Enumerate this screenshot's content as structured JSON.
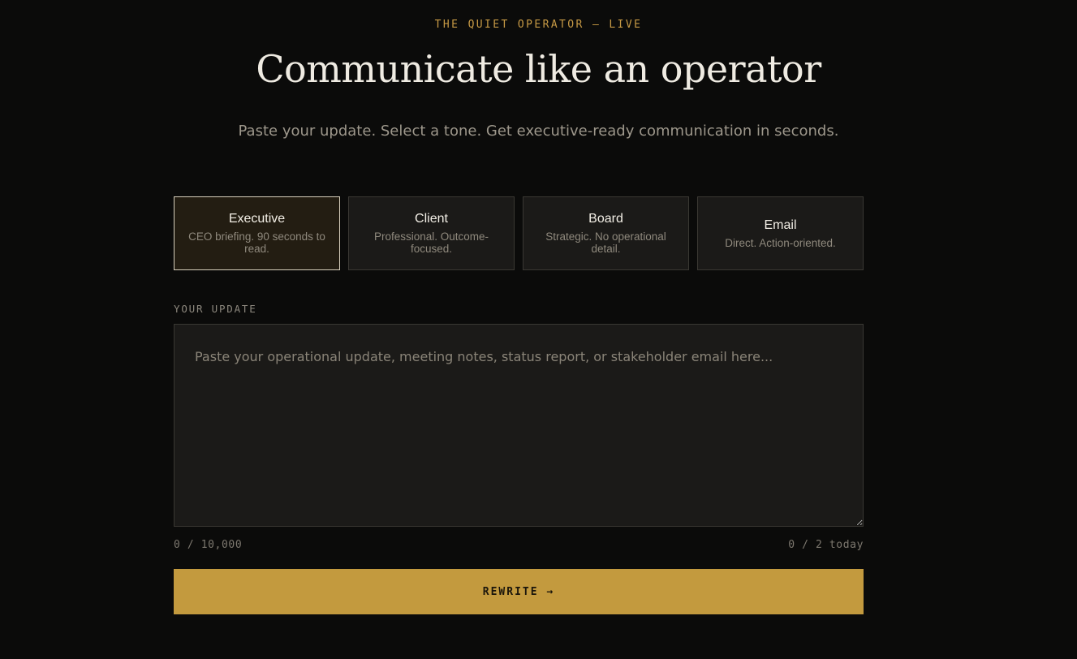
{
  "header": {
    "eyebrow": "THE QUIET OPERATOR — LIVE",
    "title": "Communicate like an operator",
    "subtitle": "Paste your update. Select a tone. Get executive-ready communication in seconds."
  },
  "tones": [
    {
      "name": "Executive",
      "description": "CEO briefing. 90 seconds to read.",
      "selected": true
    },
    {
      "name": "Client",
      "description": "Professional. Outcome-focused.",
      "selected": false
    },
    {
      "name": "Board",
      "description": "Strategic. No operational detail.",
      "selected": false
    },
    {
      "name": "Email",
      "description": "Direct. Action-oriented.",
      "selected": false
    }
  ],
  "update": {
    "label": "YOUR UPDATE",
    "value": "",
    "placeholder": "Paste your operational update, meeting notes, status report, or stakeholder email here..."
  },
  "counters": {
    "characters": "0 / 10,000",
    "daily": "0 / 2 today"
  },
  "actions": {
    "rewrite_label": "REWRITE →"
  },
  "colors": {
    "accent": "#c39a3e",
    "eyebrow": "#c79a45",
    "background": "#0b0b0a",
    "card": "#1b1a18",
    "selected_card": "#231d12"
  }
}
